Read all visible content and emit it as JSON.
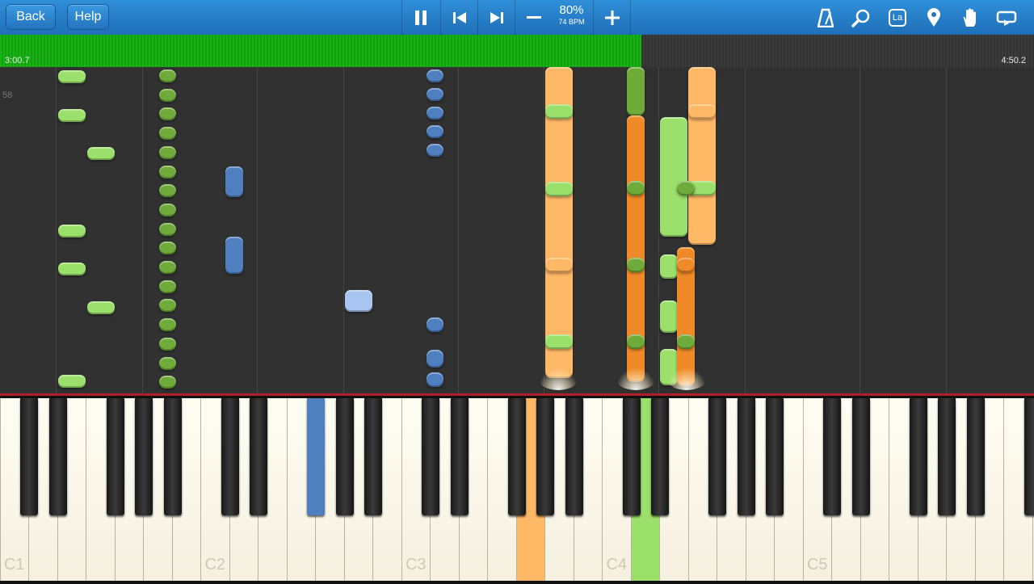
{
  "toolbar": {
    "back_label": "Back",
    "help_label": "Help",
    "speed_percent": "80%",
    "speed_bpm": "74 BPM",
    "icons": [
      "pause-icon",
      "skip-back-icon",
      "skip-forward-icon",
      "minus-icon",
      "plus-icon",
      "metronome-icon",
      "search-icon",
      "note-label-icon",
      "marker-icon",
      "hand-icon",
      "loop-icon"
    ],
    "note_label_text": "La"
  },
  "progress": {
    "elapsed": "3:00.7",
    "total": "4:50.2",
    "fraction": 0.62
  },
  "roll": {
    "measure_number": "58"
  },
  "keyboard": {
    "octave_labels": [
      "C1",
      "C2",
      "C3",
      "C4",
      "C5"
    ]
  },
  "colors": {
    "toolbar": "#2a86d1",
    "progress": "#19b315",
    "right_hand_light": "#9be06a",
    "right_hand_dark": "#6eab3a",
    "left_hand_light": "#ffb866",
    "left_hand_dark": "#f08a28",
    "extra_blue": "#4f7fbf",
    "extra_light_blue": "#a8c4f0"
  }
}
